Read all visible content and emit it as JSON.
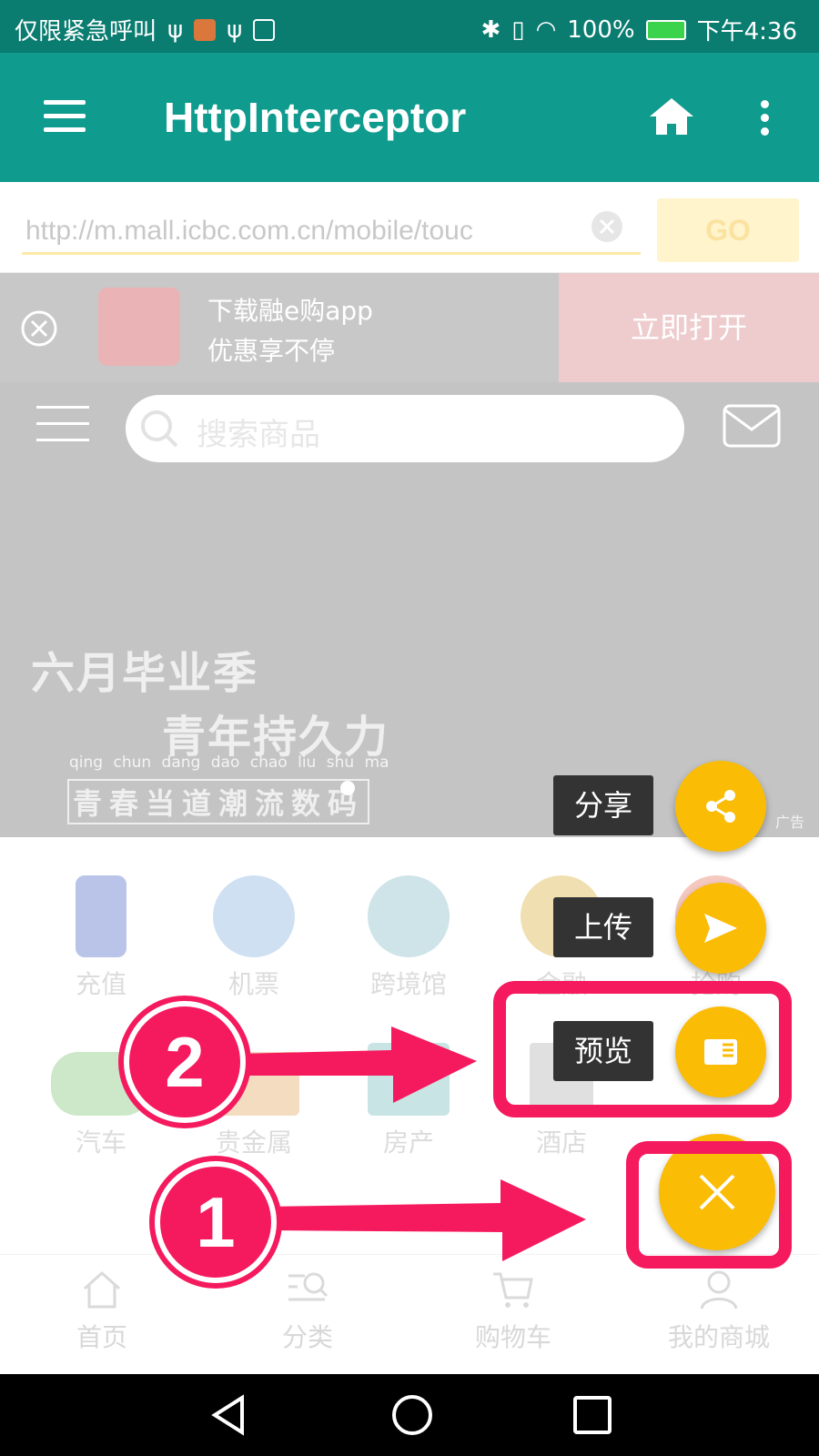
{
  "status_bar": {
    "left_text": "仅限紧急呼叫",
    "battery": "100%",
    "time": "下午4:36"
  },
  "app_bar": {
    "title": "HttpInterceptor"
  },
  "url_bar": {
    "value": "http://m.mall.icbc.com.cn/mobile/touc",
    "go_label": "GO"
  },
  "download_banner": {
    "line1": "下载融e购app",
    "line2": "优惠享不停",
    "open_label": "立即打开"
  },
  "search": {
    "placeholder": "搜索商品"
  },
  "hero": {
    "line1": "六月毕业季",
    "line2": "青年持久力",
    "pinyin": "qing chun dang dao chao liu shu ma",
    "line3": "青春当道潮流数码",
    "ad_label": "广告"
  },
  "categories": [
    {
      "label": "充值",
      "color": "#b9c4e8"
    },
    {
      "label": "机票",
      "color": "#cfe0f2"
    },
    {
      "label": "跨境馆",
      "color": "#cfe4e8"
    },
    {
      "label": "金融",
      "color": "#f0dfb0"
    },
    {
      "label": "抢购",
      "color": "#f5c9c0"
    },
    {
      "label": "汽车",
      "color": "#cde8c8"
    },
    {
      "label": "贵金属",
      "color": "#f4dcc0"
    },
    {
      "label": "房产",
      "color": "#c8e4e4"
    },
    {
      "label": "酒店",
      "color": "#e0e0e0"
    }
  ],
  "tabs": [
    {
      "label": "首页"
    },
    {
      "label": "分类"
    },
    {
      "label": "购物车"
    },
    {
      "label": "我的商城"
    }
  ],
  "fab_menu": {
    "share_label": "分享",
    "upload_label": "上传",
    "preview_label": "预览"
  },
  "annotations": {
    "step1": "1",
    "step2": "2",
    "color": "#f5195e"
  },
  "colors": {
    "app_bar": "#0f9b8e",
    "status_bar": "#0a7c70",
    "fab": "#fbbc05"
  }
}
